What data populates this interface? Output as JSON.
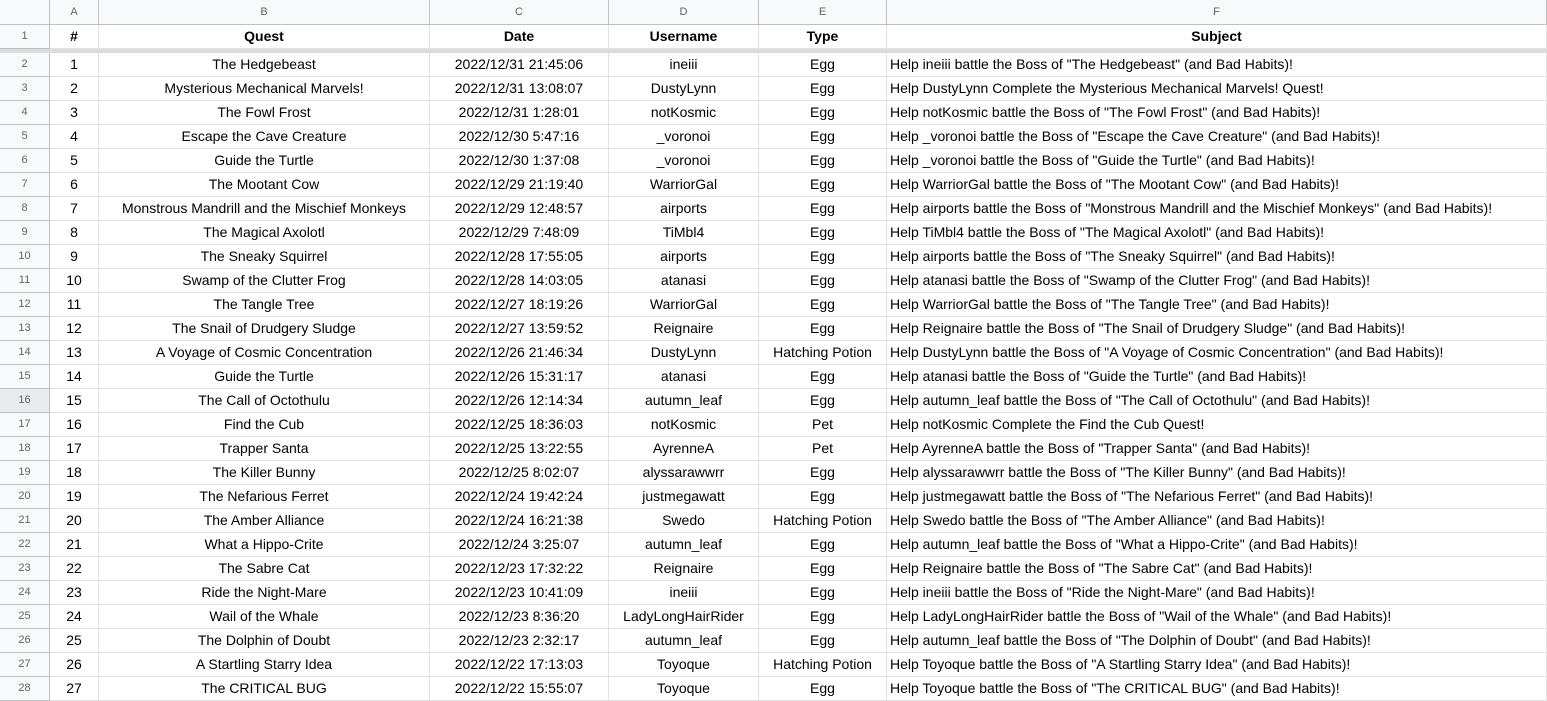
{
  "columns": [
    "A",
    "B",
    "C",
    "D",
    "E",
    "F"
  ],
  "headers": [
    "#",
    "Quest",
    "Date",
    "Username",
    "Type",
    "Subject"
  ],
  "row_header_start": 1,
  "selected_row_header": 16,
  "rows": [
    [
      "1",
      "The Hedgebeast",
      "2022/12/31 21:45:06",
      "ineiii",
      "Egg",
      "Help ineiii battle the Boss of \"The Hedgebeast\" (and Bad Habits)!"
    ],
    [
      "2",
      "Mysterious Mechanical Marvels!",
      "2022/12/31 13:08:07",
      "DustyLynn",
      "Egg",
      "Help DustyLynn Complete the Mysterious Mechanical Marvels! Quest!"
    ],
    [
      "3",
      "The Fowl Frost",
      "2022/12/31 1:28:01",
      "notKosmic",
      "Egg",
      "Help notKosmic battle the Boss of \"The Fowl Frost\" (and Bad Habits)!"
    ],
    [
      "4",
      "Escape the Cave Creature",
      "2022/12/30 5:47:16",
      "_voronoi",
      "Egg",
      "Help _voronoi battle the Boss of \"Escape the Cave Creature\" (and Bad Habits)!"
    ],
    [
      "5",
      "Guide the Turtle",
      "2022/12/30 1:37:08",
      "_voronoi",
      "Egg",
      "Help _voronoi battle the Boss of \"Guide the Turtle\" (and Bad Habits)!"
    ],
    [
      "6",
      "The Mootant Cow",
      "2022/12/29 21:19:40",
      "WarriorGal",
      "Egg",
      "Help WarriorGal battle the Boss of \"The Mootant Cow\" (and Bad Habits)!"
    ],
    [
      "7",
      "Monstrous Mandrill and the Mischief Monkeys",
      "2022/12/29 12:48:57",
      "airports",
      "Egg",
      "Help airports battle the Boss of \"Monstrous Mandrill and the Mischief Monkeys\" (and Bad Habits)!"
    ],
    [
      "8",
      "The Magical Axolotl",
      "2022/12/29 7:48:09",
      "TiMbl4",
      "Egg",
      "Help TiMbl4 battle the Boss of \"The Magical Axolotl\" (and Bad Habits)!"
    ],
    [
      "9",
      "The Sneaky Squirrel",
      "2022/12/28 17:55:05",
      "airports",
      "Egg",
      "Help airports battle the Boss of \"The Sneaky Squirrel\" (and Bad Habits)!"
    ],
    [
      "10",
      "Swamp of the Clutter Frog",
      "2022/12/28 14:03:05",
      "atanasi",
      "Egg",
      "Help atanasi battle the Boss of \"Swamp of the Clutter Frog\" (and Bad Habits)!"
    ],
    [
      "11",
      "The Tangle Tree",
      "2022/12/27 18:19:26",
      "WarriorGal",
      "Egg",
      "Help WarriorGal battle the Boss of \"The Tangle Tree\" (and Bad Habits)!"
    ],
    [
      "12",
      "The Snail of Drudgery Sludge",
      "2022/12/27 13:59:52",
      "Reignaire",
      "Egg",
      "Help Reignaire battle the Boss of \"The Snail of Drudgery Sludge\" (and Bad Habits)!"
    ],
    [
      "13",
      "A Voyage of Cosmic Concentration",
      "2022/12/26 21:46:34",
      "DustyLynn",
      "Hatching Potion",
      "Help DustyLynn battle the Boss of \"A Voyage of Cosmic Concentration\" (and Bad Habits)!"
    ],
    [
      "14",
      "Guide the Turtle",
      "2022/12/26 15:31:17",
      "atanasi",
      "Egg",
      "Help atanasi battle the Boss of \"Guide the Turtle\" (and Bad Habits)!"
    ],
    [
      "15",
      "The Call of Octothulu",
      "2022/12/26 12:14:34",
      "autumn_leaf",
      "Egg",
      "Help autumn_leaf battle the Boss of \"The Call of Octothulu\" (and Bad Habits)!"
    ],
    [
      "16",
      "Find the Cub",
      "2022/12/25 18:36:03",
      "notKosmic",
      "Pet",
      "Help notKosmic Complete the Find the Cub Quest!"
    ],
    [
      "17",
      "Trapper Santa",
      "2022/12/25 13:22:55",
      "AyrenneA",
      "Pet",
      "Help AyrenneA battle the Boss of \"Trapper Santa\" (and Bad Habits)!"
    ],
    [
      "18",
      "The Killer Bunny",
      "2022/12/25 8:02:07",
      "alyssarawwrr",
      "Egg",
      "Help alyssarawwrr battle the Boss of \"The Killer Bunny\" (and Bad Habits)!"
    ],
    [
      "19",
      "The Nefarious Ferret",
      "2022/12/24 19:42:24",
      "justmegawatt",
      "Egg",
      "Help justmegawatt battle the Boss of \"The Nefarious Ferret\" (and Bad Habits)!"
    ],
    [
      "20",
      "The Amber Alliance",
      "2022/12/24 16:21:38",
      "Swedo",
      "Hatching Potion",
      "Help Swedo battle the Boss of \"The Amber Alliance\" (and Bad Habits)!"
    ],
    [
      "21",
      "What a Hippo-Crite",
      "2022/12/24 3:25:07",
      "autumn_leaf",
      "Egg",
      "Help autumn_leaf battle the Boss of \"What a Hippo-Crite\" (and Bad Habits)!"
    ],
    [
      "22",
      "The Sabre Cat",
      "2022/12/23 17:32:22",
      "Reignaire",
      "Egg",
      "Help Reignaire battle the Boss of \"The Sabre Cat\" (and Bad Habits)!"
    ],
    [
      "23",
      "Ride the Night-Mare",
      "2022/12/23 10:41:09",
      "ineiii",
      "Egg",
      "Help ineiii battle the Boss of \"Ride the Night-Mare\" (and Bad Habits)!"
    ],
    [
      "24",
      "Wail of the Whale",
      "2022/12/23 8:36:20",
      "LadyLongHairRider",
      "Egg",
      "Help LadyLongHairRider battle the Boss of \"Wail of the Whale\" (and Bad Habits)!"
    ],
    [
      "25",
      "The Dolphin of Doubt",
      "2022/12/23 2:32:17",
      "autumn_leaf",
      "Egg",
      "Help autumn_leaf battle the Boss of \"The Dolphin of Doubt\" (and Bad Habits)!"
    ],
    [
      "26",
      "A Startling Starry Idea",
      "2022/12/22 17:13:03",
      "Toyoque",
      "Hatching Potion",
      "Help Toyoque battle the Boss of \"A Startling Starry Idea\" (and Bad Habits)!"
    ],
    [
      "27",
      "The CRITICAL BUG",
      "2022/12/22 15:55:07",
      "Toyoque",
      "Egg",
      "Help Toyoque battle the Boss of \"The CRITICAL BUG\" (and Bad Habits)!"
    ]
  ]
}
